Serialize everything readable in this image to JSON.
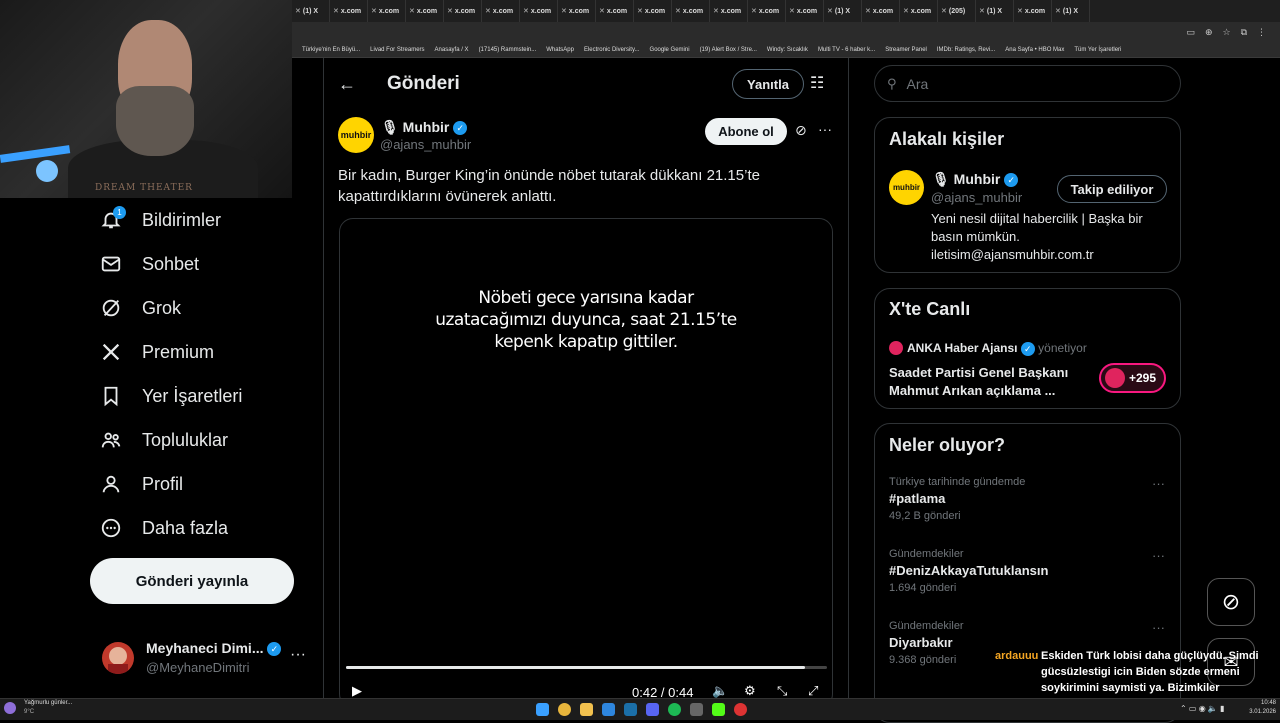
{
  "browser": {
    "tabs": [
      "(1) X",
      "x.com",
      "x.com",
      "x.com",
      "x.com",
      "x.com",
      "x.com",
      "x.com",
      "x.com",
      "x.com",
      "x.com",
      "x.com",
      "x.com",
      "x.com",
      "(1) X",
      "x.com",
      "x.com",
      "(205)",
      "(1) X",
      "x.com",
      "(1) X"
    ],
    "bookmarks": [
      "Türkiye'nin En Büyü...",
      "Livad For Streamers",
      "Anasayfa / X",
      "(17145) Rammstein...",
      "WhatsApp",
      "Electronic Diversity...",
      "Google Gemini",
      "(19) Alert Box / Stre...",
      "Windy: Sıcaklık",
      "Multi TV - 6 haber k...",
      "Streamer Panel",
      "IMDb: Ratings, Revi...",
      "Ana Sayfa • HBO Max",
      "Tüm Yer İşaretleri"
    ]
  },
  "webcam": {
    "overlay_text": "DREAM THEATER"
  },
  "sidebar": {
    "notification_count": "1",
    "items": [
      {
        "label": "Bildirimler",
        "icon": "bell-icon"
      },
      {
        "label": "Sohbet",
        "icon": "mail-icon"
      },
      {
        "label": "Grok",
        "icon": "grok-icon"
      },
      {
        "label": "Premium",
        "icon": "x-logo-icon"
      },
      {
        "label": "Yer İşaretleri",
        "icon": "bookmark-icon"
      },
      {
        "label": "Topluluklar",
        "icon": "people-icon"
      },
      {
        "label": "Profil",
        "icon": "person-icon"
      },
      {
        "label": "Daha fazla",
        "icon": "more-circle-icon"
      }
    ],
    "post_button": "Gönderi yayınla",
    "account": {
      "name": "Meyhaneci Dimi...",
      "handle": "@MeyhaneDimitri",
      "avatar_text": "DIMITER"
    }
  },
  "main": {
    "title": "Gönderi",
    "reply_button": "Yanıtla",
    "author": {
      "name": "Muhbir",
      "handle": "@ajans_muhbir",
      "avatar_text": "muhbir"
    },
    "subscribe_button": "Abone ol",
    "text": "Bir kadın, Burger King’in önünde nöbet tutarak dükkanı 21.15’te kapattırdıklarını övünerek anlattı.",
    "video": {
      "caption_lines": [
        "Nöbeti gece yarısına kadar",
        "uzatacağımızı duyunca, saat 21.15’te",
        "kepenk kapatıp gittiler."
      ],
      "time": "0:42 / 0:44",
      "progress": 0.955
    }
  },
  "right": {
    "search_placeholder": "Ara",
    "related": {
      "title": "Alakalı kişiler",
      "name": "Muhbir",
      "handle": "@ajans_muhbir",
      "follow_button": "Takip ediliyor",
      "bio": "Yeni nesil dijital habercilik | Başka bir basın mümkün. iletisim@ajansmuhbir.com.tr"
    },
    "live": {
      "title": "X'te Canlı",
      "host": "ANKA Haber Ajansı",
      "host_role": "yönetiyor",
      "headline": "Saadet Partisi Genel Başkanı Mahmut Arıkan açıklama ...",
      "listeners": "+295"
    },
    "trends": {
      "title": "Neler oluyor?",
      "items": [
        {
          "context": "Türkiye tarihinde gündemde",
          "topic": "#patlama",
          "count": "49,2 B gönderi"
        },
        {
          "context": "Gündemdekiler",
          "topic": "#DenizAkkayaTutuklansın",
          "count": "1.694 gönderi"
        },
        {
          "context": "Gündemdekiler",
          "topic": "Diyarbakır",
          "count": "9.368 gönderi"
        }
      ]
    }
  },
  "chat": {
    "user": "ardauuu",
    "message": "Eskiden Türk lobisi daha güçlüydü. Simdi gücsüzlestigi icin Biden sözde ermeni soykirimini saymisti ya. Bizimkiler gücsüzlesti, Ermenilerin ise güclendi"
  },
  "taskbar": {
    "weather": "Yağmurlu günler...",
    "temp": "9°C",
    "time": "10:48",
    "date": "3.01.2026"
  },
  "colors": {
    "accent": "#1d9bf0",
    "background": "#000000",
    "muhbir_yellow": "#ffd400"
  }
}
